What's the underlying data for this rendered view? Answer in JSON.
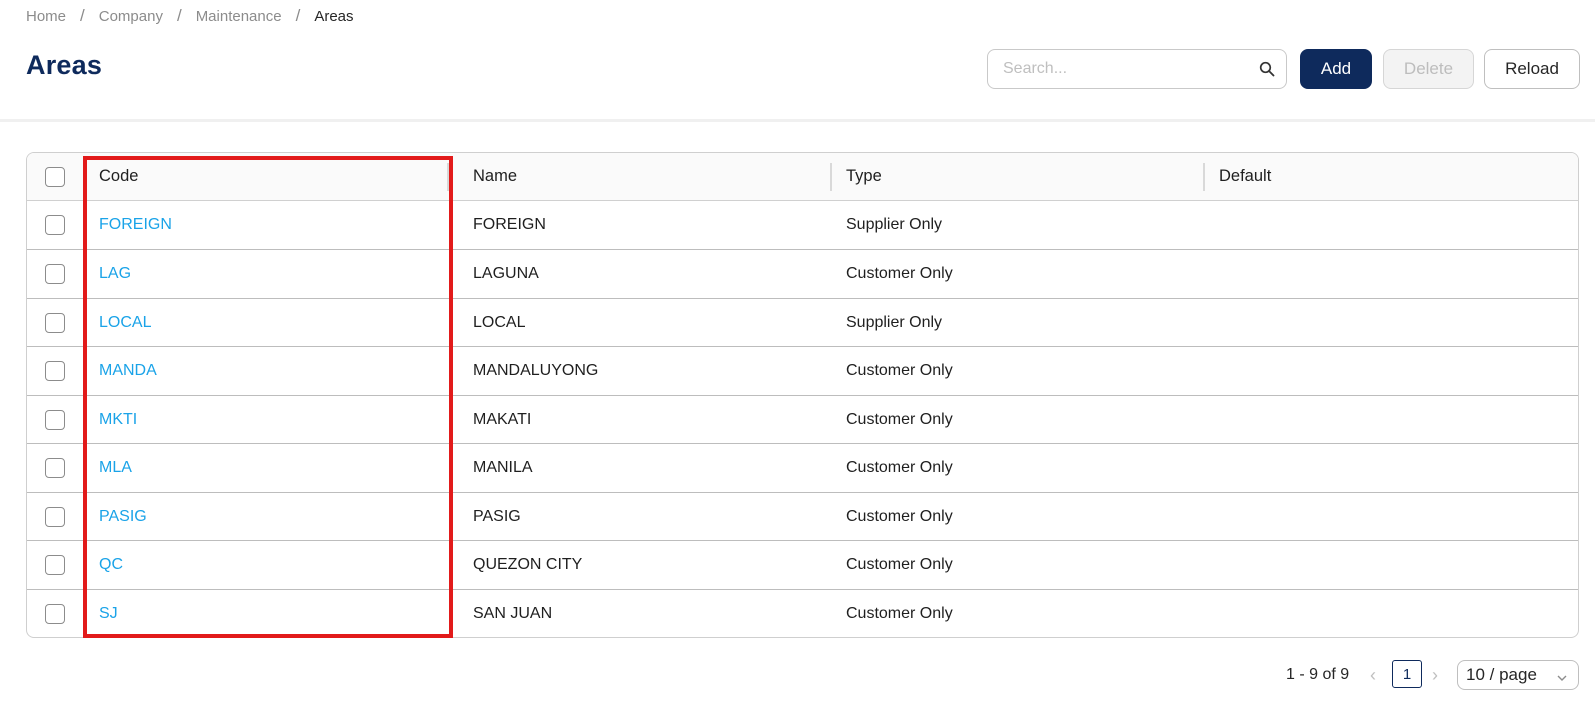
{
  "breadcrumb": [
    "Home",
    "Company",
    "Maintenance",
    "Areas"
  ],
  "page_title": "Areas",
  "search": {
    "placeholder": "Search..."
  },
  "toolbar": {
    "add_label": "Add",
    "delete_label": "Delete",
    "reload_label": "Reload"
  },
  "table": {
    "columns": [
      "Code",
      "Name",
      "Type",
      "Default"
    ],
    "rows": [
      {
        "code": "FOREIGN",
        "name": "FOREIGN",
        "type": "Supplier Only",
        "default": ""
      },
      {
        "code": "LAG",
        "name": "LAGUNA",
        "type": "Customer Only",
        "default": ""
      },
      {
        "code": "LOCAL",
        "name": "LOCAL",
        "type": "Supplier Only",
        "default": ""
      },
      {
        "code": "MANDA",
        "name": "MANDALUYONG",
        "type": "Customer Only",
        "default": ""
      },
      {
        "code": "MKTI",
        "name": "MAKATI",
        "type": "Customer Only",
        "default": ""
      },
      {
        "code": "MLA",
        "name": "MANILA",
        "type": "Customer Only",
        "default": ""
      },
      {
        "code": "PASIG",
        "name": "PASIG",
        "type": "Customer Only",
        "default": ""
      },
      {
        "code": "QC",
        "name": "QUEZON CITY",
        "type": "Customer Only",
        "default": ""
      },
      {
        "code": "SJ",
        "name": "SAN JUAN",
        "type": "Customer Only",
        "default": ""
      }
    ]
  },
  "pagination": {
    "summary": "1 - 9 of 9",
    "current_page": "1",
    "page_size": "10 / page"
  },
  "colors": {
    "primary": "#0e2a5c",
    "link": "#1aa3e8",
    "highlight": "#e21a1a"
  },
  "icons": [
    "search-icon",
    "chevron-left-icon",
    "chevron-right-icon",
    "chevron-down-icon"
  ]
}
